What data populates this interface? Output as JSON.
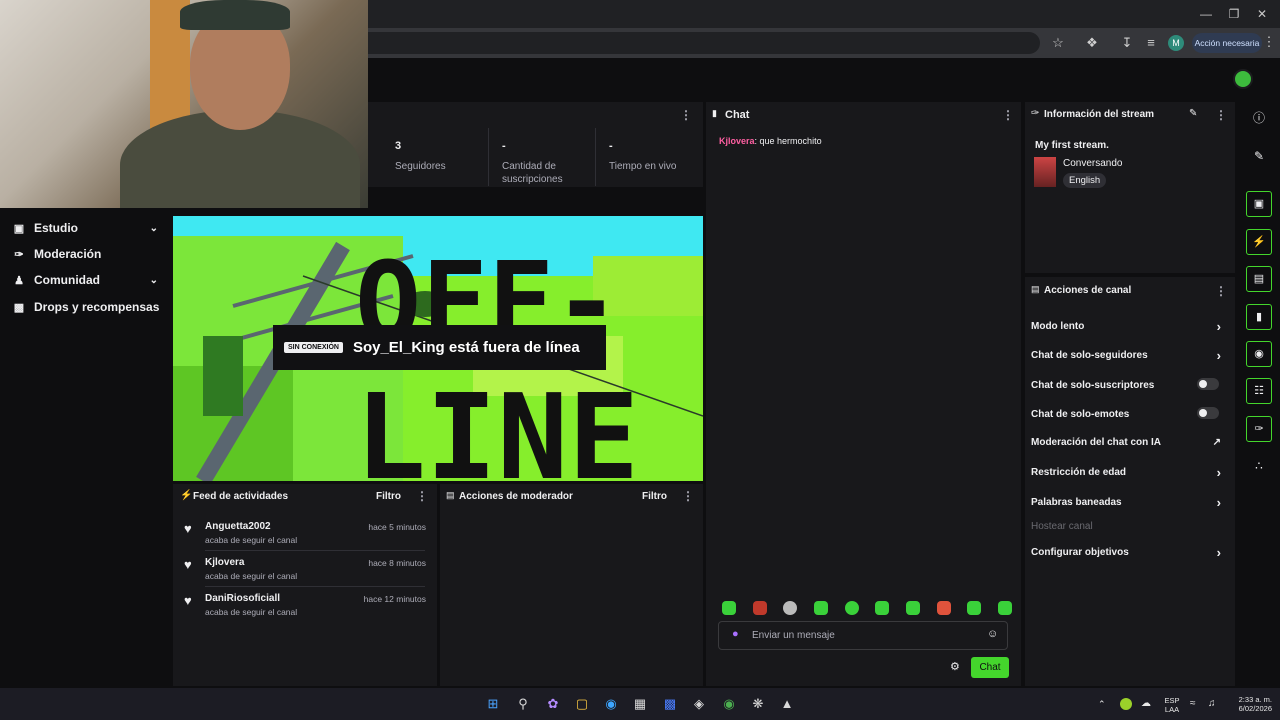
{
  "browser": {
    "minimize_icon": "minimize-icon",
    "maximize_icon": "restore-icon",
    "close_icon": "close-icon",
    "profile_initial": "M",
    "accion_label": "Acción necesaria"
  },
  "nav": {
    "items": [
      {
        "label": "Estudio",
        "icon": "studio-icon"
      },
      {
        "label": "Moderación",
        "icon": "wrench-icon"
      },
      {
        "label": "Comunidad",
        "icon": "people-icon"
      },
      {
        "label": "Drops y recompensas",
        "icon": "chart-icon"
      }
    ]
  },
  "stats": [
    {
      "value": "3",
      "label": "Seguidores"
    },
    {
      "value": "-",
      "label": "Cantidad de suscripciones"
    },
    {
      "value": "-",
      "label": "Tiempo en vivo"
    }
  ],
  "video": {
    "offline_tag": "SIN CONEXIÓN",
    "offline_text": "Soy_El_King está fuera de línea",
    "art_text_1": "OFF-",
    "art_text_2": "LINE"
  },
  "feed": {
    "title": "Feed de actividades",
    "filter": "Filtro",
    "items": [
      {
        "name": "Anguetta2002",
        "sub": "acaba de seguir el canal",
        "time": "hace 5 minutos"
      },
      {
        "name": "Kjlovera",
        "sub": "acaba de seguir el canal",
        "time": "hace 8 minutos"
      },
      {
        "name": "DaniRiosoficiall",
        "sub": "acaba de seguir el canal",
        "time": "hace 12 minutos"
      }
    ]
  },
  "modactions": {
    "title": "Acciones de moderador",
    "filter": "Filtro"
  },
  "chat": {
    "title": "Chat",
    "messages": [
      {
        "user": "Kjlovera",
        "text": ": que hermochito"
      }
    ],
    "placeholder": "Enviar un mensaje",
    "send_label": "Chat",
    "user_color": "#ff5fa2"
  },
  "streaminfo": {
    "title": "Información del stream",
    "stream_title": "My first stream.",
    "category": "Conversando",
    "language": "English"
  },
  "channel_actions": {
    "title": "Acciones de canal",
    "items": [
      {
        "label": "Modo lento",
        "control": "chevron"
      },
      {
        "label": "Chat de solo-seguidores",
        "control": "chevron"
      },
      {
        "label": "Chat de solo-suscriptores",
        "control": "toggle"
      },
      {
        "label": "Chat de solo-emotes",
        "control": "toggle"
      },
      {
        "label": "Moderación del chat con IA",
        "control": "external"
      },
      {
        "label": "Restricción de edad",
        "control": "chevron"
      },
      {
        "label": "Palabras baneadas",
        "control": "chevron"
      },
      {
        "label": "Hostear canal",
        "control": "none"
      },
      {
        "label": "Configurar objetivos",
        "control": "chevron"
      }
    ]
  },
  "taskbar": {
    "lang_1": "ESP",
    "lang_2": "LAA",
    "time": "2:33 a. m.",
    "date": "6/02/2026"
  },
  "colors": {
    "accent": "#44d62c",
    "background": "#0e0e10",
    "panel": "#18181b"
  }
}
